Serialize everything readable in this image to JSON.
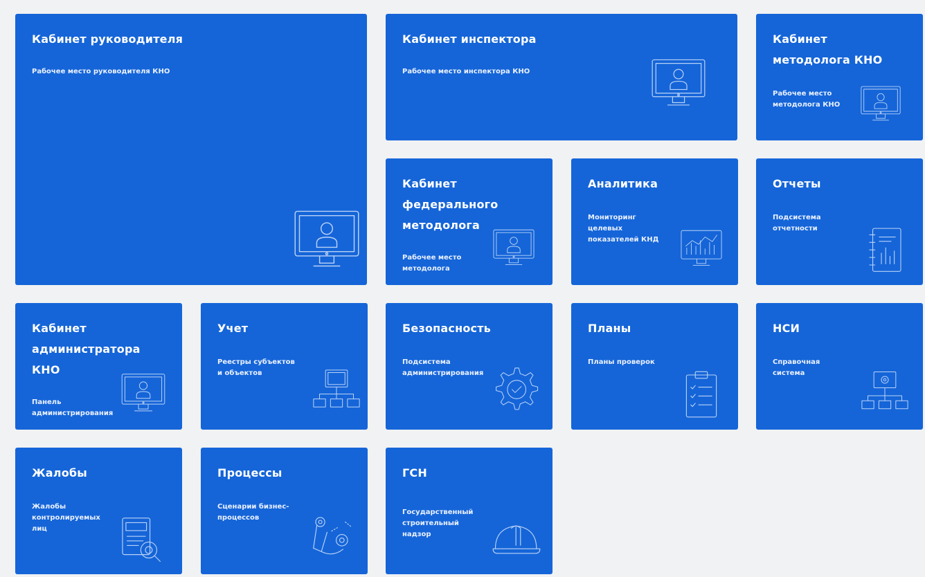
{
  "tiles": [
    {
      "title": "Кабинет руководителя",
      "sub": "Рабочее место руководителя КНО",
      "icon": "computer-user-icon"
    },
    {
      "title": "Кабинет инспектора",
      "sub": "Рабочее место инспектора КНО",
      "icon": "computer-user-icon"
    },
    {
      "title": "Кабинет\nметодолога КНО",
      "sub": "Рабочее место\nметодолога КНО",
      "icon": "computer-user-icon"
    },
    {
      "title": "Кабинет\nфедерального\nметодолога",
      "sub": "Рабочее место\nметодолога",
      "icon": "computer-user-icon"
    },
    {
      "title": "Аналитика",
      "sub": "Мониторинг\nцелевых\nпоказателей КНД",
      "icon": "monitor-chart-icon"
    },
    {
      "title": "Отчеты",
      "sub": "Подсистема\nотчетности",
      "icon": "report-icon"
    },
    {
      "title": "Кабинет\nадминистратора\nКНО",
      "sub": "Панель\nадминистрирования",
      "icon": "computer-user-icon"
    },
    {
      "title": "Учет",
      "sub": "Реестры субъектов\nи объектов",
      "icon": "registry-network-icon"
    },
    {
      "title": "Безопасность",
      "sub": "Подсистема\nадминистрирования",
      "icon": "gear-check-icon"
    },
    {
      "title": "Планы",
      "sub": "Планы проверок",
      "icon": "clipboard-checklist-icon"
    },
    {
      "title": "НСИ",
      "sub": "Справочная\nсистема",
      "icon": "reference-monitor-network-icon"
    },
    {
      "title": "Жалобы",
      "sub": "Жалобы\nконтролируемых\nлиц",
      "icon": "document-search-icon"
    },
    {
      "title": "Процессы",
      "sub": "Сценарии бизнес-\nпроцессов",
      "icon": "process-flow-icon"
    },
    {
      "title": "ГСН",
      "sub": "Государственный\nстроительный\nнадзор",
      "icon": "hardhat-icon"
    }
  ]
}
